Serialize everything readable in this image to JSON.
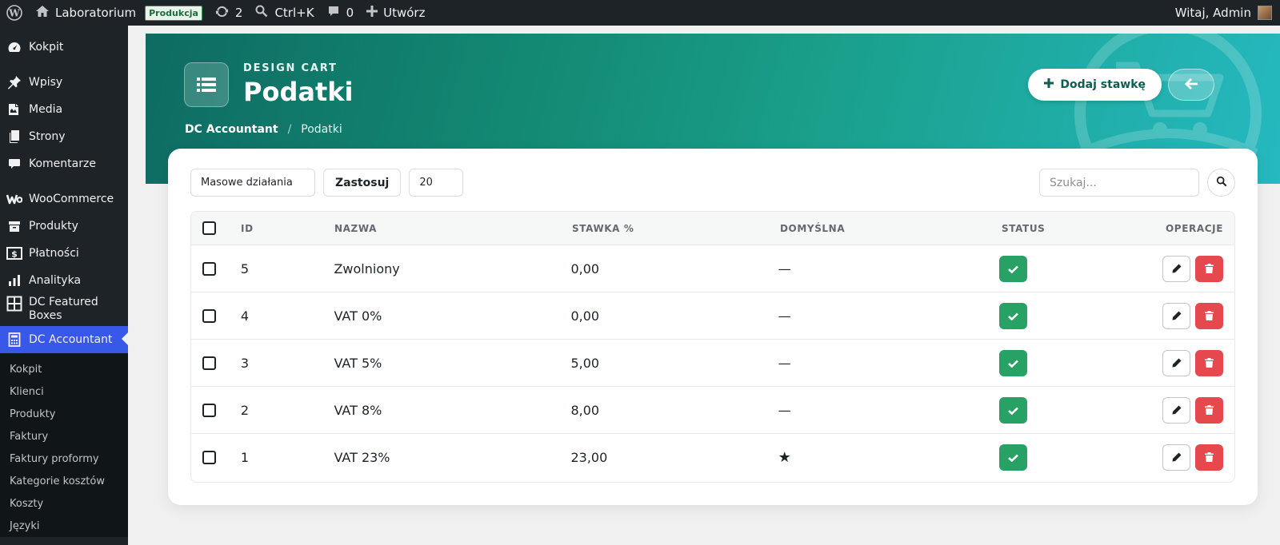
{
  "adminbar": {
    "site_name": "Laboratorium",
    "env_badge": "Produkcja",
    "updates_count": "2",
    "search_shortcut": "Ctrl+K",
    "comments_count": "0",
    "create_label": "Utwórz",
    "greeting": "Witaj, Admin"
  },
  "sidebar": {
    "items": [
      {
        "label": "Kokpit",
        "icon": "dashboard-icon"
      },
      {
        "label": "Wpisy",
        "icon": "pin-icon"
      },
      {
        "label": "Media",
        "icon": "media-icon"
      },
      {
        "label": "Strony",
        "icon": "pages-icon"
      },
      {
        "label": "Komentarze",
        "icon": "comment-icon"
      },
      {
        "label": "WooCommerce",
        "icon": "woocommerce-icon"
      },
      {
        "label": "Produkty",
        "icon": "archive-icon"
      },
      {
        "label": "Płatności",
        "icon": "money-icon"
      },
      {
        "label": "Analityka",
        "icon": "chart-icon"
      },
      {
        "label": "DC Featured Boxes",
        "icon": "grid-icon"
      },
      {
        "label": "DC Accountant",
        "icon": "calculator-icon"
      }
    ],
    "submenu": [
      "Kokpit",
      "Klienci",
      "Produkty",
      "Faktury",
      "Faktury proformy",
      "Kategorie kosztów",
      "Koszty",
      "Języki"
    ]
  },
  "hero": {
    "kicker": "DESIGN CART",
    "title": "Podatki",
    "breadcrumb_root": "DC Accountant",
    "breadcrumb_sep": "/",
    "breadcrumb_current": "Podatki",
    "add_button": "Dodaj stawkę"
  },
  "toolbar": {
    "bulk_actions": "Masowe działania",
    "apply": "Zastosuj",
    "per_page": "20",
    "search_placeholder": "Szukaj..."
  },
  "table": {
    "headers": [
      "ID",
      "NAZWA",
      "STAWKA %",
      "DOMYŚLNA",
      "STATUS",
      "OPERACJE"
    ],
    "rows": [
      {
        "id": "5",
        "name": "Zwolniony",
        "rate": "0,00",
        "default": "—"
      },
      {
        "id": "4",
        "name": "VAT 0%",
        "rate": "0,00",
        "default": "—"
      },
      {
        "id": "3",
        "name": "VAT 5%",
        "rate": "5,00",
        "default": "—"
      },
      {
        "id": "2",
        "name": "VAT 8%",
        "rate": "8,00",
        "default": "—"
      },
      {
        "id": "1",
        "name": "VAT 23%",
        "rate": "23,00",
        "default": "★"
      }
    ]
  },
  "colors": {
    "accent": "#3858e9",
    "hero_start": "#0e6b62",
    "hero_end": "#25b9c0",
    "status_ok": "#28a164",
    "delete": "#e5484d"
  }
}
